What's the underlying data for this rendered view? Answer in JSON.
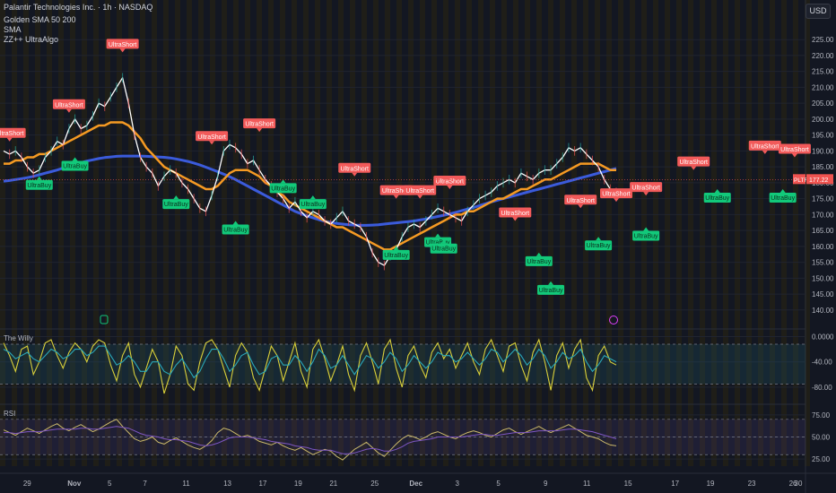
{
  "header": {
    "symbol": "Palantir Technologies Inc. · 1h · NASDAQ",
    "ind1": "Golden SMA 50 200",
    "ind2": "SMA",
    "ind3": "ZZ++ UltraAlgo"
  },
  "currency": "USD",
  "price_tag": {
    "ticker": "PLTR",
    "value": "177.22"
  },
  "pane_titles": {
    "willy": "The Willy",
    "rsi": "RSI"
  },
  "colors": {
    "bg": "#131722",
    "price": "#ffffff",
    "sma50": "#f59a23",
    "sma200": "#3b5bdb",
    "short": "#f25a5a",
    "buy": "#12c97a",
    "willy": "#d8cf3a",
    "willy_sig": "#2aa7b8",
    "rsi": "#c9b86a",
    "rsi_sig": "#7e57c2",
    "stripe": "#2a2410"
  },
  "chart_data": [
    {
      "type": "line",
      "title": "",
      "x_ticks": [
        "29",
        "Nov",
        "5",
        "7",
        "11",
        "13",
        "17",
        "19",
        "21",
        "25",
        "Dec",
        "3",
        "5",
        "9",
        "11",
        "15",
        "17",
        "19",
        "23",
        "26",
        "30"
      ],
      "x_tick_idx": [
        4,
        12,
        18,
        24,
        31,
        38,
        44,
        50,
        56,
        63,
        70,
        77,
        84,
        92,
        99,
        106,
        114,
        120,
        127,
        134,
        141
      ],
      "ylim": [
        136,
        229
      ],
      "yticks": [
        140,
        145,
        150,
        155,
        160,
        165,
        170,
        175,
        180,
        185,
        190,
        195,
        200,
        205,
        210,
        215,
        220,
        225
      ],
      "series": [
        {
          "key": "price",
          "values": [
            190,
            189,
            190,
            188,
            185,
            183,
            184,
            188,
            190,
            193,
            192,
            197,
            200,
            197,
            198,
            201,
            205,
            204,
            207,
            210,
            213,
            205,
            195,
            188,
            185,
            183,
            179,
            182,
            184,
            183,
            180,
            178,
            175,
            172,
            171,
            176,
            182,
            190,
            192,
            191,
            189,
            186,
            187,
            184,
            181,
            179,
            177,
            175,
            172,
            174,
            171,
            169,
            171,
            170,
            168,
            167,
            169,
            171,
            168,
            167,
            166,
            163,
            158,
            155,
            154,
            157,
            159,
            163,
            166,
            167,
            166,
            168,
            170,
            172,
            171,
            170,
            169,
            168,
            171,
            173,
            175,
            176,
            177,
            179,
            180,
            181,
            180,
            183,
            182,
            181,
            183,
            184,
            184,
            186,
            188,
            191,
            190,
            191,
            189,
            187,
            185,
            181,
            178,
            177
          ]
        },
        {
          "key": "sma50",
          "values": [
            186,
            186,
            187,
            187,
            188,
            188,
            189,
            189,
            190,
            191,
            192,
            193,
            194,
            195,
            196,
            197,
            198,
            198,
            199,
            199,
            199,
            198,
            196,
            194,
            191,
            189,
            187,
            185,
            184,
            183,
            182,
            181,
            180,
            179,
            178,
            178,
            179,
            181,
            183,
            184,
            184,
            184,
            183,
            182,
            180,
            179,
            177,
            176,
            174,
            173,
            172,
            171,
            170,
            169,
            168,
            167,
            166,
            166,
            165,
            164,
            163,
            162,
            161,
            160,
            159,
            159,
            160,
            161,
            162,
            163,
            164,
            165,
            166,
            167,
            168,
            169,
            170,
            170,
            171,
            171,
            172,
            173,
            174,
            175,
            175,
            176,
            177,
            178,
            178,
            179,
            180,
            181,
            181,
            182,
            183,
            184,
            185,
            186,
            186,
            186,
            186,
            185,
            184,
            184
          ]
        },
        {
          "key": "sma200",
          "values": [
            180.5,
            180.7,
            181,
            181.3,
            181.6,
            182,
            182.5,
            183,
            183.5,
            184,
            184.6,
            185.2,
            185.8,
            186.3,
            186.8,
            187.2,
            187.6,
            187.9,
            188.1,
            188.3,
            188.4,
            188.4,
            188.4,
            188.4,
            188.3,
            188.2,
            188.1,
            188,
            187.8,
            187.5,
            187.1,
            186.7,
            186.2,
            185.6,
            184.9,
            184.2,
            183.5,
            182.7,
            181.9,
            181,
            180,
            179,
            178,
            177,
            176,
            175,
            174,
            173,
            172,
            171,
            170.3,
            169.6,
            169,
            168.4,
            167.9,
            167.5,
            167.2,
            167,
            166.8,
            166.7,
            166.6,
            166.6,
            166.7,
            166.8,
            167,
            167.2,
            167.4,
            167.6,
            167.8,
            168,
            168.3,
            168.6,
            169,
            169.4,
            169.8,
            170.2,
            170.7,
            171.2,
            171.7,
            172.2,
            172.8,
            173.4,
            174,
            174.5,
            175,
            175.5,
            176,
            176.5,
            177,
            177.5,
            178,
            178.5,
            179,
            179.5,
            180,
            180.5,
            181,
            181.5,
            182,
            182.5,
            183,
            183.5,
            184,
            184.5
          ]
        }
      ],
      "labels": [
        {
          "kind": "short",
          "text": "UltraShort",
          "i": 1,
          "y": 193
        },
        {
          "kind": "buy",
          "text": "UltraBuy",
          "i": 6,
          "y": 182
        },
        {
          "kind": "short",
          "text": "UltraShort",
          "i": 11,
          "y": 202
        },
        {
          "kind": "buy",
          "text": "UltraBuy",
          "i": 12,
          "y": 188
        },
        {
          "kind": "short",
          "text": "UltraShort",
          "i": 20,
          "y": 221
        },
        {
          "kind": "buy",
          "text": "UltraBuy",
          "i": 29,
          "y": 176
        },
        {
          "kind": "short",
          "text": "UltraShort",
          "i": 35,
          "y": 192
        },
        {
          "kind": "buy",
          "text": "UltraBuy",
          "i": 39,
          "y": 168
        },
        {
          "kind": "short",
          "text": "UltraShort",
          "i": 43,
          "y": 196
        },
        {
          "kind": "buy",
          "text": "UltraBuy",
          "i": 47,
          "y": 181
        },
        {
          "kind": "buy",
          "text": "UltraBuy",
          "i": 52,
          "y": 176
        },
        {
          "kind": "short",
          "text": "UltraShort",
          "i": 59,
          "y": 182
        },
        {
          "kind": "short",
          "text": "UltraShort",
          "i": 66,
          "y": 175
        },
        {
          "kind": "short",
          "text": "UltraShort",
          "i": 70,
          "y": 175
        },
        {
          "kind": "buy",
          "text": "UltraBuy",
          "i": 66,
          "y": 160
        },
        {
          "kind": "buy",
          "text": "UltraBuy",
          "i": 73,
          "y": 164
        },
        {
          "kind": "short",
          "text": "UltraShort",
          "i": 75,
          "y": 178
        },
        {
          "kind": "buy",
          "text": "UltraBuy",
          "i": 74,
          "y": 162
        },
        {
          "kind": "short",
          "text": "UltraShort",
          "i": 86,
          "y": 168
        },
        {
          "kind": "buy",
          "text": "UltraBuy",
          "i": 90,
          "y": 158
        },
        {
          "kind": "buy",
          "text": "UltraBuy",
          "i": 92,
          "y": 149
        },
        {
          "kind": "short",
          "text": "UltraShort",
          "i": 97,
          "y": 172
        },
        {
          "kind": "buy",
          "text": "UltraBuy",
          "i": 100,
          "y": 163
        },
        {
          "kind": "short",
          "text": "UltraShort",
          "i": 103,
          "y": 174
        },
        {
          "kind": "short",
          "text": "UltraShort",
          "i": 108,
          "y": 176
        },
        {
          "kind": "buy",
          "text": "UltraBuy",
          "i": 108,
          "y": 166
        },
        {
          "kind": "short",
          "text": "UltraShort",
          "i": 116,
          "y": 184
        },
        {
          "kind": "buy",
          "text": "UltraBuy",
          "i": 120,
          "y": 178
        },
        {
          "kind": "short",
          "text": "UltraShort",
          "i": 128,
          "y": 189
        },
        {
          "kind": "short",
          "text": "UltraShort",
          "i": 133,
          "y": 188
        },
        {
          "kind": "buy",
          "text": "UltraBuy",
          "i": 131,
          "y": 178
        }
      ]
    },
    {
      "type": "line",
      "ylim": [
        -100,
        5
      ],
      "yticks_labels": [
        "0.0000",
        "-40.00",
        "-80.00"
      ],
      "yticks": [
        0,
        -40,
        -80
      ],
      "series": [
        {
          "key": "willy",
          "values": [
            -10,
            -30,
            -55,
            -20,
            -15,
            -60,
            -40,
            -10,
            -5,
            -30,
            -50,
            -25,
            -10,
            -20,
            -40,
            -15,
            -5,
            -10,
            -45,
            -70,
            -30,
            -10,
            -60,
            -80,
            -50,
            -20,
            -40,
            -90,
            -60,
            -15,
            -30,
            -75,
            -85,
            -40,
            -10,
            -5,
            -20,
            -50,
            -80,
            -30,
            -10,
            -25,
            -65,
            -85,
            -50,
            -15,
            -30,
            -70,
            -40,
            -10,
            -55,
            -80,
            -20,
            -5,
            -35,
            -70,
            -45,
            -15,
            -60,
            -85,
            -30,
            -10,
            -40,
            -75,
            -20,
            -5,
            -50,
            -80,
            -30,
            -15,
            -45,
            -65,
            -25,
            -10,
            -35,
            -20,
            -50,
            -30,
            -10,
            -40,
            -60,
            -20,
            -5,
            -30,
            -55,
            -15,
            -10,
            -45,
            -70,
            -25,
            -5,
            -40,
            -85,
            -30,
            -10,
            -50,
            -20,
            -5,
            -65,
            -85,
            -30,
            -15,
            -40,
            -45
          ]
        },
        {
          "key": "willy_sig",
          "values": [
            -20,
            -25,
            -35,
            -30,
            -25,
            -35,
            -40,
            -30,
            -20,
            -25,
            -35,
            -30,
            -20,
            -20,
            -30,
            -25,
            -15,
            -15,
            -30,
            -45,
            -40,
            -30,
            -40,
            -55,
            -55,
            -40,
            -40,
            -55,
            -60,
            -45,
            -35,
            -50,
            -65,
            -55,
            -35,
            -20,
            -20,
            -35,
            -55,
            -45,
            -30,
            -25,
            -45,
            -60,
            -55,
            -35,
            -30,
            -45,
            -45,
            -30,
            -40,
            -55,
            -40,
            -20,
            -30,
            -50,
            -45,
            -30,
            -45,
            -60,
            -45,
            -30,
            -35,
            -50,
            -40,
            -25,
            -35,
            -55,
            -45,
            -30,
            -40,
            -50,
            -40,
            -25,
            -30,
            -30,
            -40,
            -35,
            -25,
            -35,
            -45,
            -35,
            -20,
            -25,
            -40,
            -30,
            -20,
            -30,
            -45,
            -35,
            -20,
            -30,
            -50,
            -40,
            -25,
            -35,
            -30,
            -20,
            -40,
            -55,
            -45,
            -30,
            -35,
            -40
          ]
        }
      ]
    },
    {
      "type": "line",
      "ylim": [
        15,
        82
      ],
      "yticks": [
        75,
        50,
        25
      ],
      "yticks_labels": [
        "75.00",
        "50.00",
        "25.00"
      ],
      "series": [
        {
          "key": "rsi",
          "values": [
            58,
            55,
            52,
            56,
            60,
            57,
            54,
            58,
            62,
            65,
            60,
            57,
            61,
            64,
            60,
            56,
            59,
            63,
            67,
            70,
            62,
            55,
            48,
            45,
            47,
            50,
            44,
            42,
            46,
            49,
            45,
            41,
            38,
            36,
            40,
            46,
            55,
            60,
            58,
            54,
            50,
            52,
            49,
            45,
            43,
            41,
            44,
            40,
            37,
            35,
            38,
            34,
            30,
            33,
            36,
            34,
            28,
            24,
            30,
            36,
            40,
            44,
            38,
            32,
            28,
            35,
            42,
            48,
            52,
            50,
            47,
            50,
            54,
            56,
            53,
            50,
            48,
            52,
            55,
            57,
            55,
            52,
            50,
            54,
            58,
            60,
            56,
            53,
            56,
            59,
            62,
            58,
            55,
            58,
            61,
            64,
            60,
            56,
            52,
            50,
            48,
            44,
            41,
            40
          ]
        },
        {
          "key": "rsi_sig",
          "values": [
            55,
            55,
            54,
            55,
            56,
            56,
            56,
            57,
            58,
            59,
            59,
            59,
            59,
            60,
            60,
            59,
            59,
            60,
            61,
            62,
            61,
            60,
            57,
            54,
            52,
            51,
            50,
            48,
            47,
            47,
            46,
            45,
            43,
            41,
            40,
            41,
            43,
            46,
            49,
            50,
            50,
            50,
            49,
            48,
            47,
            45,
            44,
            43,
            42,
            40,
            39,
            38,
            36,
            35,
            35,
            35,
            33,
            31,
            31,
            32,
            34,
            36,
            37,
            36,
            34,
            34,
            36,
            39,
            43,
            45,
            46,
            47,
            48,
            50,
            50,
            50,
            50,
            50,
            51,
            52,
            53,
            53,
            52,
            52,
            53,
            54,
            55,
            55,
            55,
            56,
            57,
            57,
            57,
            57,
            58,
            59,
            59,
            58,
            57,
            56,
            54,
            52,
            50,
            48
          ]
        }
      ]
    }
  ]
}
